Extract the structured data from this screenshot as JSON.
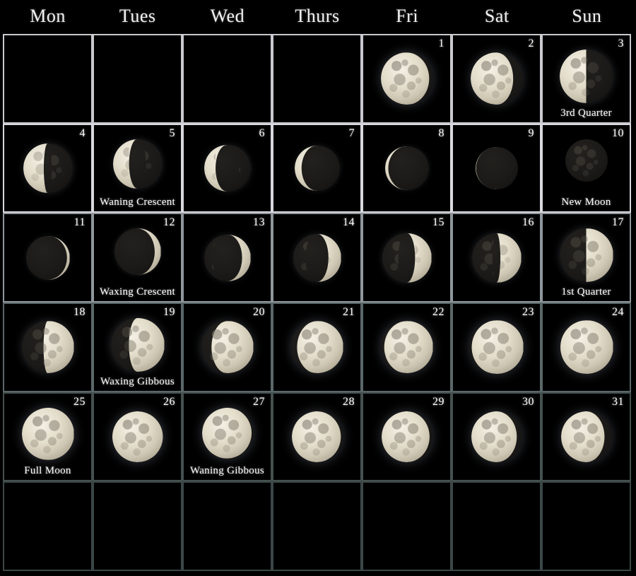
{
  "header": {
    "days": [
      "Mon",
      "Tues",
      "Wed",
      "Thurs",
      "Fri",
      "Sat",
      "Sun"
    ]
  },
  "calendar": {
    "columns": 7,
    "rows": 6,
    "first_day_column": "Fri",
    "days_in_month": 31,
    "colors": {
      "background": "#000000",
      "text": "#ffffff",
      "border_bright": "#d8d8de",
      "border_dim": "#3b4746",
      "moon_lit": "#e3ddcb",
      "moon_dark": "#1b1a18"
    },
    "cells": [
      {
        "row": 0,
        "col": 0,
        "day": null,
        "phase_label": null,
        "moon": null
      },
      {
        "row": 0,
        "col": 1,
        "day": null,
        "phase_label": null,
        "moon": null
      },
      {
        "row": 0,
        "col": 2,
        "day": null,
        "phase_label": null,
        "moon": null
      },
      {
        "row": 0,
        "col": 3,
        "day": null,
        "phase_label": null,
        "moon": null
      },
      {
        "row": 0,
        "col": 4,
        "day": "1",
        "phase_label": null,
        "moon": {
          "illumination": 0.93,
          "lit_side": "left",
          "size": 74
        }
      },
      {
        "row": 0,
        "col": 5,
        "day": "2",
        "phase_label": null,
        "moon": {
          "illumination": 0.82,
          "lit_side": "left",
          "size": 74
        }
      },
      {
        "row": 0,
        "col": 6,
        "day": "3",
        "phase_label": "3rd Quarter",
        "moon": {
          "illumination": 0.5,
          "lit_side": "left",
          "size": 76
        }
      },
      {
        "row": 1,
        "col": 0,
        "day": "4",
        "phase_label": null,
        "moon": {
          "illumination": 0.42,
          "lit_side": "left",
          "size": 70
        }
      },
      {
        "row": 1,
        "col": 1,
        "day": "5",
        "phase_label": "Waning Crescent",
        "moon": {
          "illumination": 0.33,
          "lit_side": "left",
          "size": 70
        }
      },
      {
        "row": 1,
        "col": 2,
        "day": "6",
        "phase_label": null,
        "moon": {
          "illumination": 0.25,
          "lit_side": "left",
          "size": 66
        }
      },
      {
        "row": 1,
        "col": 3,
        "day": "7",
        "phase_label": null,
        "moon": {
          "illumination": 0.16,
          "lit_side": "left",
          "size": 64
        }
      },
      {
        "row": 1,
        "col": 4,
        "day": "8",
        "phase_label": null,
        "moon": {
          "illumination": 0.08,
          "lit_side": "left",
          "size": 62
        }
      },
      {
        "row": 1,
        "col": 5,
        "day": "9",
        "phase_label": null,
        "moon": {
          "illumination": 0.02,
          "lit_side": "left",
          "size": 60
        }
      },
      {
        "row": 1,
        "col": 6,
        "day": "10",
        "phase_label": "New Moon",
        "moon": {
          "illumination": 0.0,
          "lit_side": "left",
          "size": 60
        }
      },
      {
        "row": 2,
        "col": 0,
        "day": "11",
        "phase_label": null,
        "moon": {
          "illumination": 0.06,
          "lit_side": "right",
          "size": 62
        }
      },
      {
        "row": 2,
        "col": 1,
        "day": "12",
        "phase_label": "Waxing Crescent",
        "moon": {
          "illumination": 0.13,
          "lit_side": "right",
          "size": 66
        }
      },
      {
        "row": 2,
        "col": 2,
        "day": "13",
        "phase_label": null,
        "moon": {
          "illumination": 0.18,
          "lit_side": "right",
          "size": 66
        }
      },
      {
        "row": 2,
        "col": 3,
        "day": "14",
        "phase_label": null,
        "moon": {
          "illumination": 0.26,
          "lit_side": "right",
          "size": 68
        }
      },
      {
        "row": 2,
        "col": 4,
        "day": "15",
        "phase_label": null,
        "moon": {
          "illumination": 0.33,
          "lit_side": "right",
          "size": 70
        }
      },
      {
        "row": 2,
        "col": 5,
        "day": "16",
        "phase_label": null,
        "moon": {
          "illumination": 0.42,
          "lit_side": "right",
          "size": 70
        }
      },
      {
        "row": 2,
        "col": 6,
        "day": "17",
        "phase_label": "1st Quarter",
        "moon": {
          "illumination": 0.5,
          "lit_side": "right",
          "size": 76
        }
      },
      {
        "row": 3,
        "col": 0,
        "day": "18",
        "phase_label": null,
        "moon": {
          "illumination": 0.58,
          "lit_side": "right",
          "size": 74
        }
      },
      {
        "row": 3,
        "col": 1,
        "day": "19",
        "phase_label": "Waxing Gibbous",
        "moon": {
          "illumination": 0.66,
          "lit_side": "right",
          "size": 76
        }
      },
      {
        "row": 3,
        "col": 2,
        "day": "20",
        "phase_label": null,
        "moon": {
          "illumination": 0.8,
          "lit_side": "right",
          "size": 74
        }
      },
      {
        "row": 3,
        "col": 3,
        "day": "21",
        "phase_label": null,
        "moon": {
          "illumination": 0.88,
          "lit_side": "right",
          "size": 74
        }
      },
      {
        "row": 3,
        "col": 4,
        "day": "22",
        "phase_label": null,
        "moon": {
          "illumination": 0.93,
          "lit_side": "right",
          "size": 74
        }
      },
      {
        "row": 3,
        "col": 5,
        "day": "23",
        "phase_label": null,
        "moon": {
          "illumination": 0.96,
          "lit_side": "right",
          "size": 76
        }
      },
      {
        "row": 3,
        "col": 6,
        "day": "24",
        "phase_label": null,
        "moon": {
          "illumination": 0.98,
          "lit_side": "right",
          "size": 76
        }
      },
      {
        "row": 4,
        "col": 0,
        "day": "25",
        "phase_label": "Full Moon",
        "moon": {
          "illumination": 1.0,
          "lit_side": "right",
          "size": 74
        }
      },
      {
        "row": 4,
        "col": 1,
        "day": "26",
        "phase_label": null,
        "moon": {
          "illumination": 1.0,
          "lit_side": "left",
          "size": 72
        }
      },
      {
        "row": 4,
        "col": 2,
        "day": "27",
        "phase_label": "Waning Gibbous",
        "moon": {
          "illumination": 0.98,
          "lit_side": "left",
          "size": 72
        }
      },
      {
        "row": 4,
        "col": 3,
        "day": "28",
        "phase_label": null,
        "moon": {
          "illumination": 0.97,
          "lit_side": "left",
          "size": 72
        }
      },
      {
        "row": 4,
        "col": 4,
        "day": "29",
        "phase_label": null,
        "moon": {
          "illumination": 0.95,
          "lit_side": "left",
          "size": 72
        }
      },
      {
        "row": 4,
        "col": 5,
        "day": "30",
        "phase_label": null,
        "moon": {
          "illumination": 0.9,
          "lit_side": "left",
          "size": 72
        }
      },
      {
        "row": 4,
        "col": 6,
        "day": "31",
        "phase_label": null,
        "moon": {
          "illumination": 0.86,
          "lit_side": "left",
          "size": 72
        }
      },
      {
        "row": 5,
        "col": 0,
        "day": null,
        "phase_label": null,
        "moon": null
      },
      {
        "row": 5,
        "col": 1,
        "day": null,
        "phase_label": null,
        "moon": null
      },
      {
        "row": 5,
        "col": 2,
        "day": null,
        "phase_label": null,
        "moon": null
      },
      {
        "row": 5,
        "col": 3,
        "day": null,
        "phase_label": null,
        "moon": null
      },
      {
        "row": 5,
        "col": 4,
        "day": null,
        "phase_label": null,
        "moon": null
      },
      {
        "row": 5,
        "col": 5,
        "day": null,
        "phase_label": null,
        "moon": null
      },
      {
        "row": 5,
        "col": 6,
        "day": null,
        "phase_label": null,
        "moon": null
      }
    ]
  }
}
